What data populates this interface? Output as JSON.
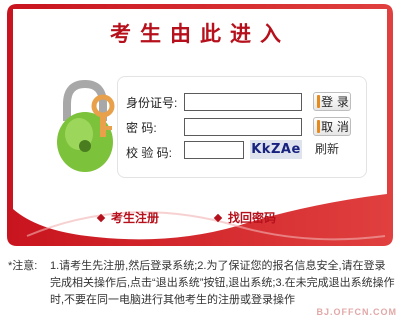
{
  "title": "考生由此进入",
  "form": {
    "id_label": "身份证号:",
    "password_label": "密 码:",
    "captcha_label": "校 验 码:",
    "id_value": "",
    "password_value": "",
    "captcha_value": "",
    "captcha_text": "KkZAe",
    "refresh_label": "刷新",
    "login_label": "登 录",
    "cancel_label": "取 消"
  },
  "links": {
    "register": "考生注册",
    "recover": "找回密码"
  },
  "notice": {
    "prefix": "*注意:",
    "text": "1.请考生先注册,然后登录系统;2.为了保证您的报名信息安全,请在登录完成相关操作后,点击“退出系统”按钮,退出系统;3.在未完成退出系统操作时,不要在同一电脑进行其他考生的注册或登录操作"
  },
  "watermark": "BJ.OFFCN.COM",
  "colors": {
    "accent": "#b5101b",
    "button_bar": "#e68a1e",
    "captcha_text": "#17237e",
    "lock_green": "#7cc23a",
    "key_orange": "#e8a04a"
  },
  "icons": {
    "lock": "padlock-with-key-icon",
    "bullet": "diamond-bullet-icon"
  }
}
